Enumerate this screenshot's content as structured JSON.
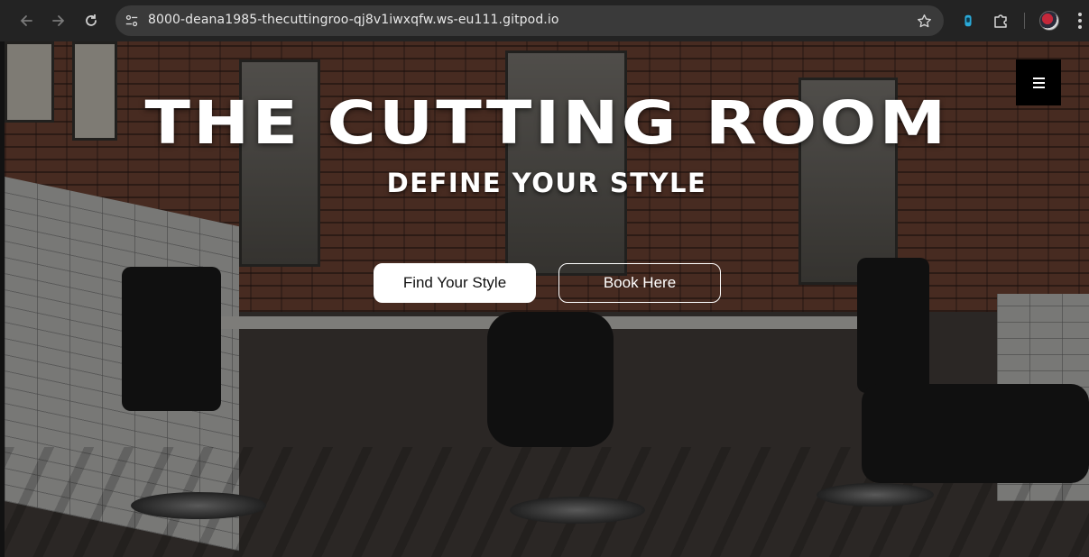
{
  "browser": {
    "url": "8000-deana1985-thecuttingroo-qj8v1iwxqfw.ws-eu111.gitpod.io",
    "icons": {
      "back": "back-arrow-icon",
      "forward": "forward-arrow-icon",
      "reload": "reload-icon",
      "site_info": "site-settings-icon",
      "bookmark": "star-icon",
      "extension_a": "extension-icon",
      "extensions": "puzzle-icon",
      "profile": "avatar",
      "menu": "kebab-menu-icon"
    }
  },
  "hero": {
    "title": "THE CUTTING ROOM",
    "subtitle": "DEFINE YOUR STYLE",
    "primary_button": "Find Your Style",
    "secondary_button": "Book Here"
  },
  "nav": {
    "toggle_icon": "hamburger-menu-icon"
  },
  "colors": {
    "chrome_bg": "#232323",
    "omnibox_bg": "#3a3a3a",
    "hero_text": "#ffffff",
    "menu_toggle_bg": "#000000",
    "primary_button_bg": "#ffffff"
  }
}
